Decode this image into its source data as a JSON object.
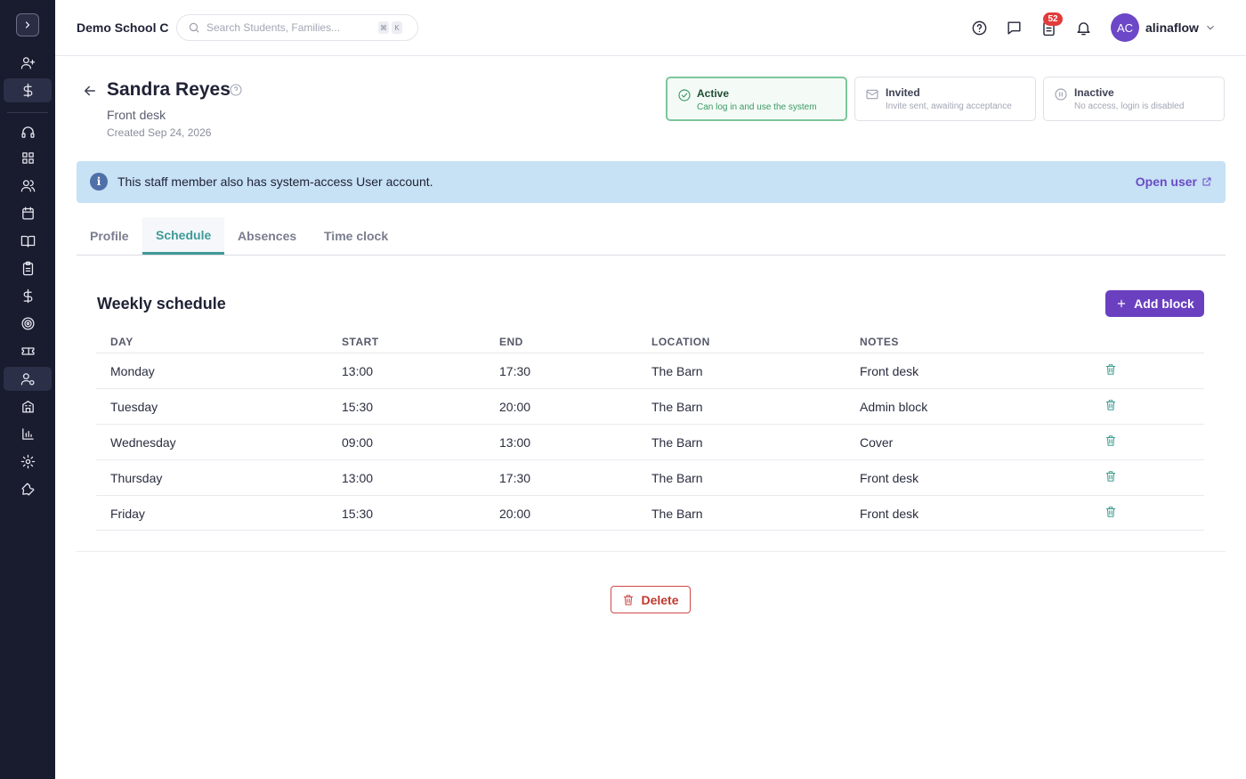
{
  "header": {
    "school_name": "Demo School C",
    "search_placeholder": "Search Students, Families...",
    "search_shortcut": [
      "⌘",
      "K"
    ],
    "notification_count": "52",
    "user_initials": "AC",
    "username": "alinaflow"
  },
  "sidebar": {
    "items": [
      {
        "icon": "user-plus-icon"
      },
      {
        "icon": "dollar-icon"
      },
      {
        "icon": "headset-icon"
      },
      {
        "icon": "dashboard-icon"
      },
      {
        "icon": "users-icon"
      },
      {
        "icon": "calendar-icon"
      },
      {
        "icon": "book-icon"
      },
      {
        "icon": "clipboard-icon"
      },
      {
        "icon": "dollar-icon"
      },
      {
        "icon": "target-icon"
      },
      {
        "icon": "ticket-icon"
      },
      {
        "icon": "staff-icon",
        "active": true
      },
      {
        "icon": "building-icon"
      },
      {
        "icon": "chart-icon"
      },
      {
        "icon": "gear-icon"
      },
      {
        "icon": "wrench-icon"
      }
    ]
  },
  "person": {
    "name": "Sandra Reyes",
    "role": "Front desk",
    "created": "Created Sep 24, 2026"
  },
  "status_options": [
    {
      "title": "Active",
      "subtitle": "Can log in and use the system",
      "selected": true,
      "color": "#3a9863"
    },
    {
      "title": "Invited",
      "subtitle": "Invite sent, awaiting acceptance",
      "selected": false
    },
    {
      "title": "Inactive",
      "subtitle": "No access, login is disabled",
      "selected": false
    }
  ],
  "banner": {
    "text": "This staff member also has system-access User account.",
    "link": "Open user"
  },
  "tabs": [
    {
      "label": "Profile",
      "active": false
    },
    {
      "label": "Schedule",
      "active": true
    },
    {
      "label": "Absences",
      "active": false
    },
    {
      "label": "Time clock",
      "active": false
    }
  ],
  "schedule": {
    "title": "Weekly schedule",
    "add_button": "Add block",
    "columns": [
      "DAY",
      "START",
      "END",
      "LOCATION",
      "NOTES"
    ],
    "rows": [
      {
        "day": "Monday",
        "start": "13:00",
        "end": "17:30",
        "location": "The Barn",
        "notes": "Front desk"
      },
      {
        "day": "Tuesday",
        "start": "15:30",
        "end": "20:00",
        "location": "The Barn",
        "notes": "Admin block"
      },
      {
        "day": "Wednesday",
        "start": "09:00",
        "end": "13:00",
        "location": "The Barn",
        "notes": "Cover"
      },
      {
        "day": "Thursday",
        "start": "13:00",
        "end": "17:30",
        "location": "The Barn",
        "notes": "Front desk"
      },
      {
        "day": "Friday",
        "start": "15:30",
        "end": "20:00",
        "location": "The Barn",
        "notes": "Front desk"
      }
    ]
  },
  "actions": {
    "delete": "Delete"
  },
  "colors": {
    "sidebar_bg": "#191b2e",
    "accent_purple": "#6a40c0",
    "accent_teal": "#3f9a98",
    "danger": "#d04848",
    "banner_bg": "#c7e1f5"
  }
}
